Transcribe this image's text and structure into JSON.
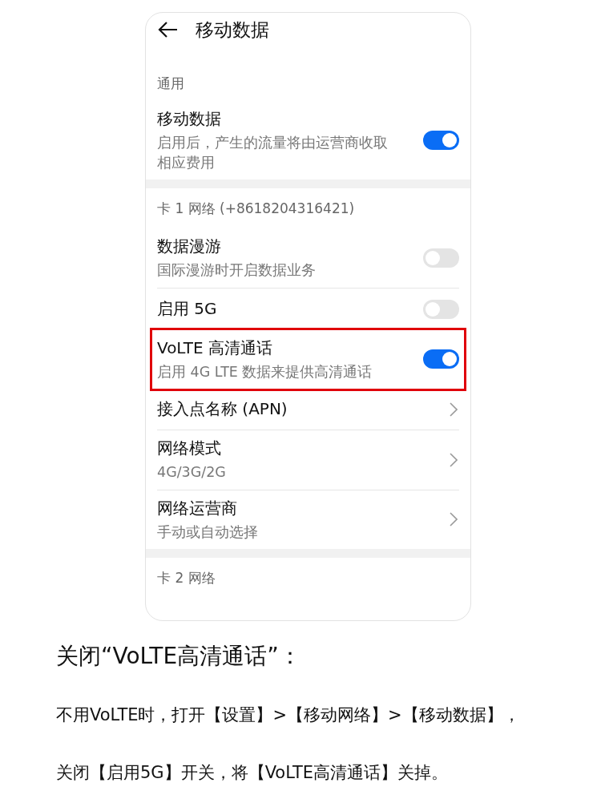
{
  "screen": {
    "title": "移动数据",
    "sections": [
      {
        "label": "通用",
        "items": [
          {
            "kind": "toggle",
            "title": "移动数据",
            "subtitle": "启用后，产生的流量将由运营商收取相应费用",
            "on": true,
            "highlighted": false
          }
        ]
      },
      {
        "label": "卡 1 网络 (+8618204316421)",
        "items": [
          {
            "kind": "toggle",
            "title": "数据漫游",
            "subtitle": "国际漫游时开启数据业务",
            "on": false,
            "highlighted": false
          },
          {
            "kind": "toggle",
            "title": "启用 5G",
            "on": false,
            "highlighted": false
          },
          {
            "kind": "toggle",
            "title": "VoLTE 高清通话",
            "subtitle": "启用 4G LTE 数据来提供高清通话",
            "on": true,
            "highlighted": true
          },
          {
            "kind": "link",
            "title": "接入点名称 (APN)",
            "highlighted": false
          },
          {
            "kind": "link",
            "title": "网络模式",
            "subtitle": "4G/3G/2G",
            "highlighted": false
          },
          {
            "kind": "link",
            "title": "网络运营商",
            "subtitle": "手动或自动选择",
            "highlighted": false
          }
        ]
      },
      {
        "label": "卡 2 网络"
      }
    ]
  },
  "article": {
    "heading": "关闭“VoLTE高清通话”：",
    "paragraphs": [
      "不用VoLTE时，打开【设置】>【移动网络】>【移动数据】，",
      "关闭【启用5G】开关，将【VoLTE高清通话】关掉。"
    ]
  }
}
